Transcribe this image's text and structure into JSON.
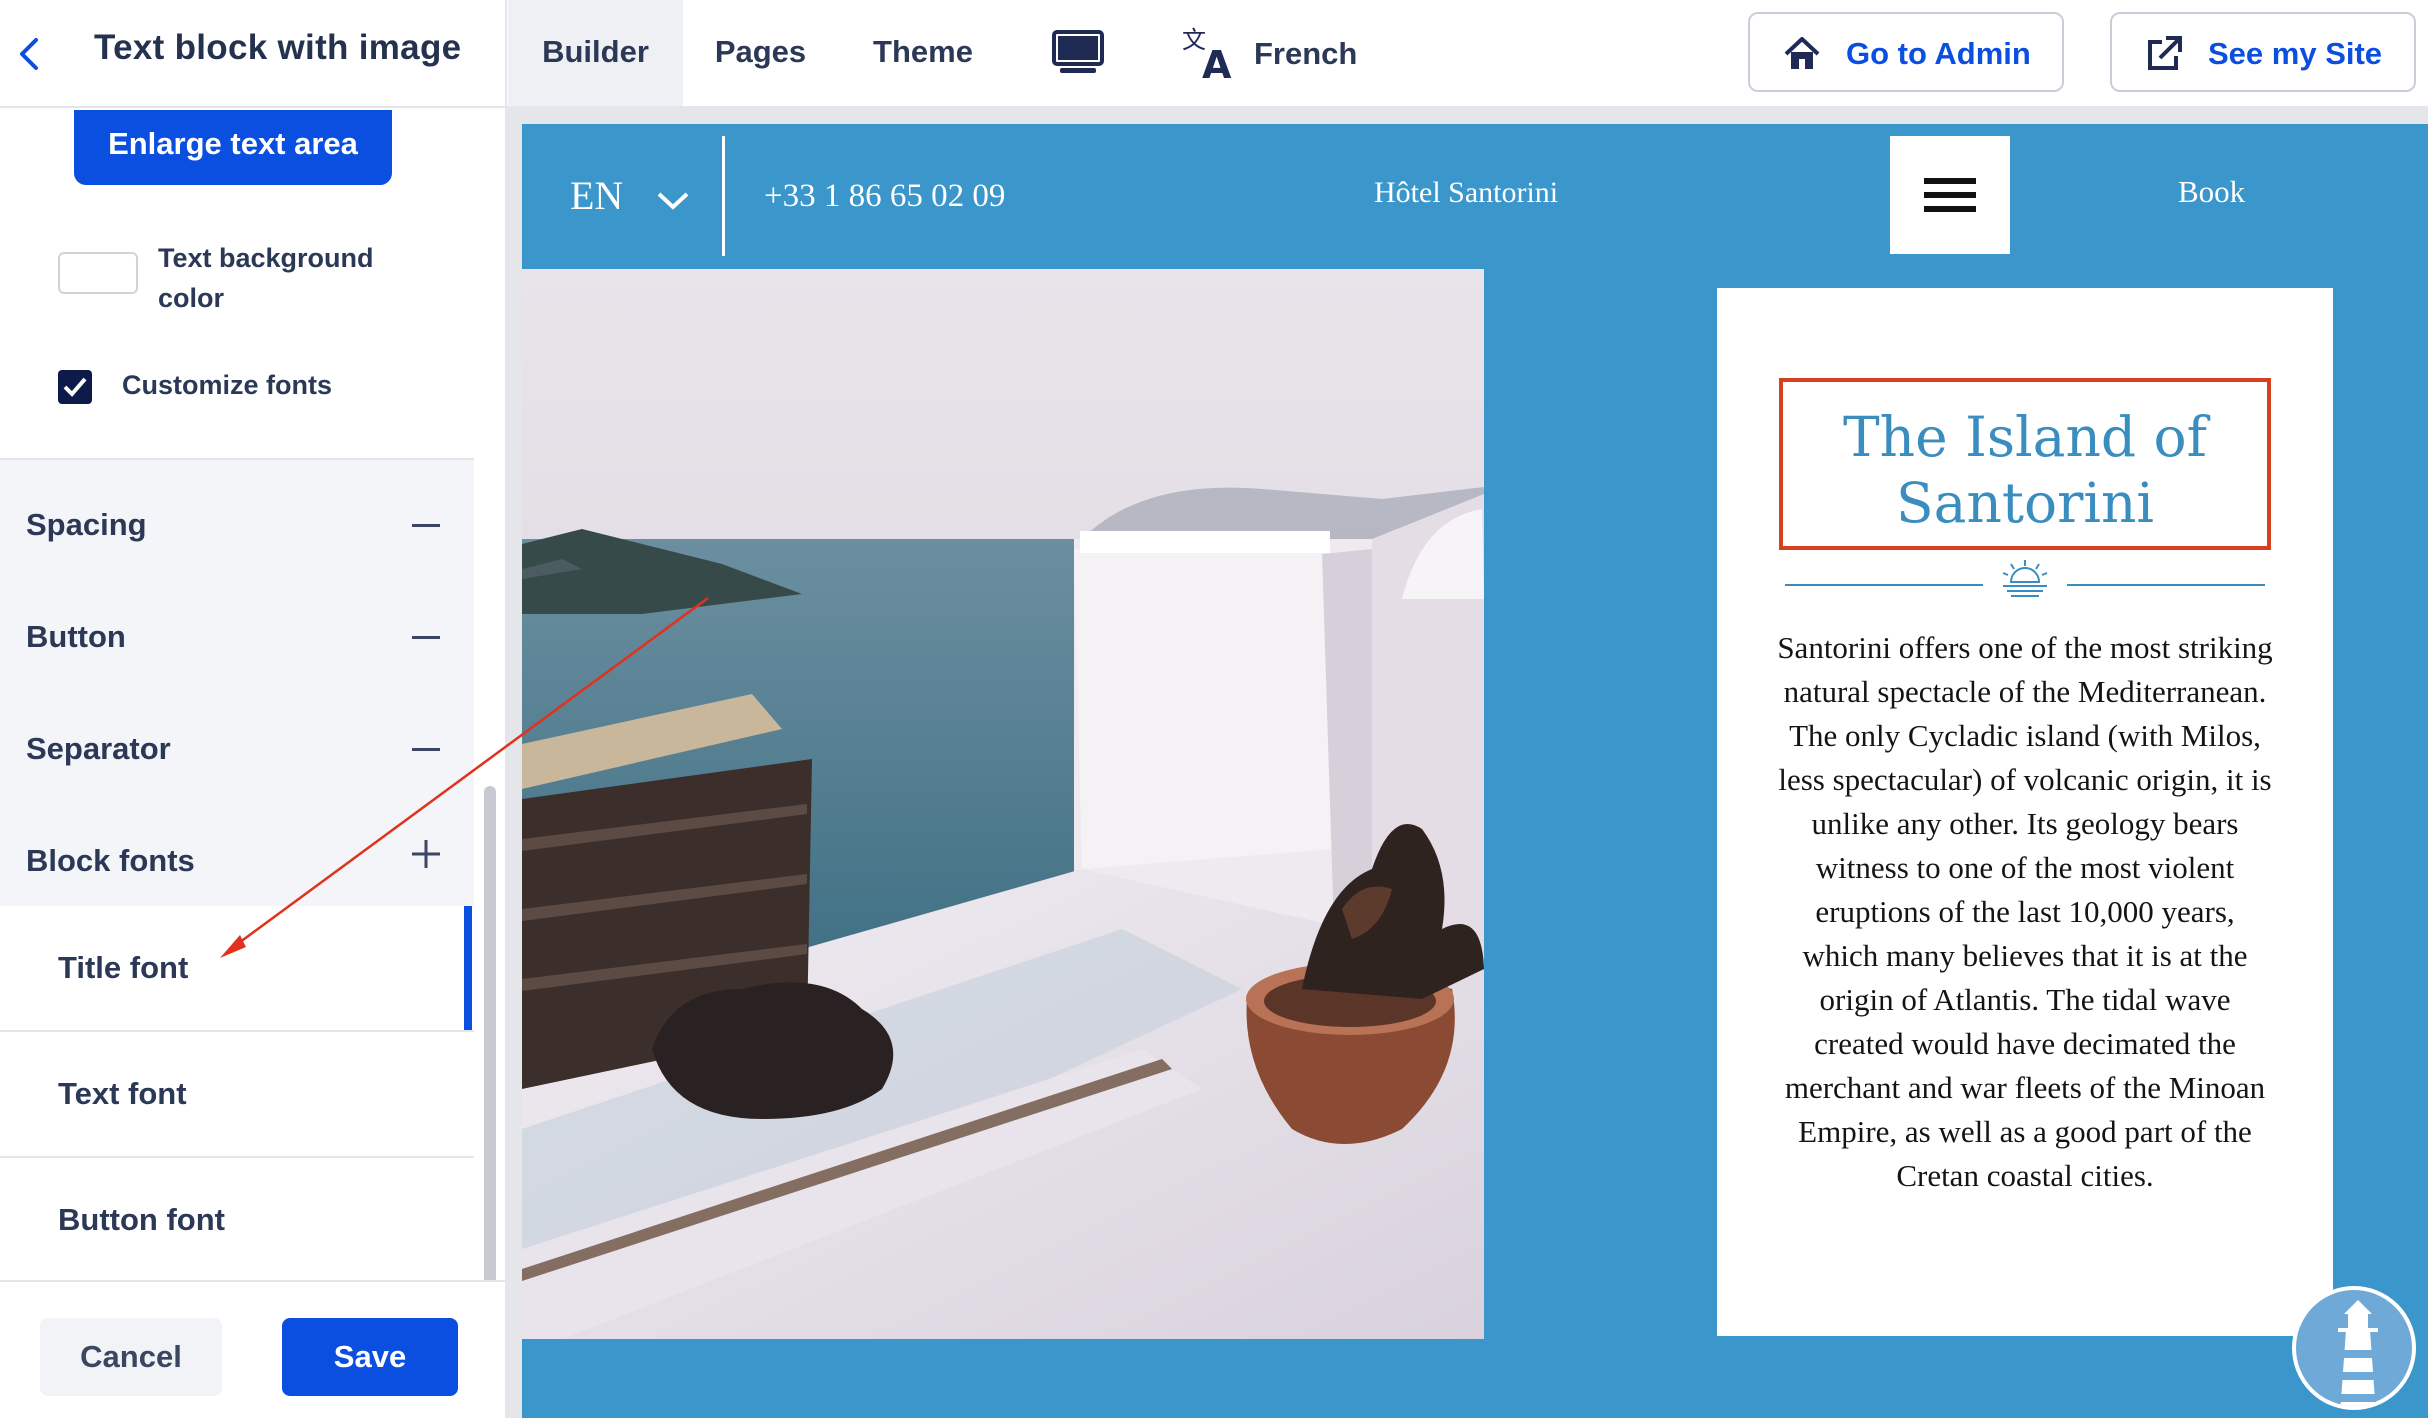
{
  "topbar": {
    "panel_title": "Text block with image",
    "tabs": [
      "Builder",
      "Pages",
      "Theme"
    ],
    "language_label": "French",
    "go_to_admin": "Go to Admin",
    "see_my_site": "See my Site",
    "icons": {
      "back": "chevron-left-icon",
      "device": "desktop-icon",
      "language": "translate-icon",
      "admin": "home-icon",
      "site": "external-link-icon"
    }
  },
  "left_panel": {
    "enlarge_button": "Enlarge text area",
    "text_background_color": "Text background color",
    "customize_fonts": {
      "label": "Customize fonts",
      "checked": true
    },
    "sections": [
      {
        "label": "Spacing",
        "state": "collapsed"
      },
      {
        "label": "Button",
        "state": "collapsed"
      },
      {
        "label": "Separator",
        "state": "collapsed"
      },
      {
        "label": "Block fonts",
        "state": "expanded"
      }
    ],
    "block_fonts_items": [
      {
        "label": "Title font",
        "active": true
      },
      {
        "label": "Text font",
        "active": false
      },
      {
        "label": "Button font",
        "active": false
      }
    ],
    "footer": {
      "cancel": "Cancel",
      "save": "Save"
    }
  },
  "preview": {
    "header": {
      "language": "EN",
      "phone": "+33 1 86 65 02 09",
      "hotel_name": "Hôtel Santorini",
      "book": "Book"
    },
    "card": {
      "title": "The Island of Santorini",
      "body": "Santorini offers one of the most striking natural spectacle of the Mediterranean. The only Cycladic island (with Milos, less spectacular) of volcanic origin, it is unlike any other. Its geology bears witness to one of the most violent eruptions of the last 10,000 years, which many believes that it is at the origin of Atlantis. The tidal wave created would have decimated the merchant and war fleets of the Minoan Empire, as well as a good part of the Cretan coastal cities."
    }
  },
  "colors": {
    "accent": "#0b4fe0",
    "preview_background": "#3a96cb",
    "title_color": "#3a8dbf",
    "annotation": "#d6401f"
  }
}
